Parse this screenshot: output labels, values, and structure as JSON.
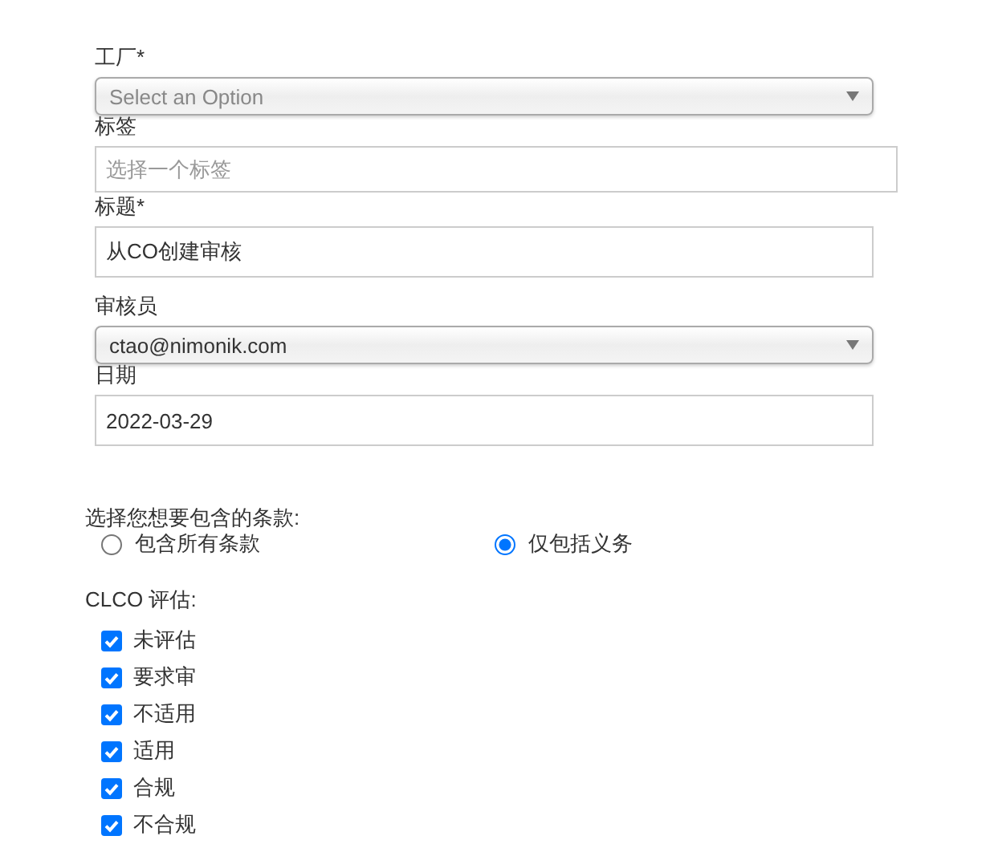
{
  "fields": [
    {
      "kind": "select",
      "label": "工厂*",
      "placeholder": "Select an Option"
    },
    {
      "kind": "tag-input",
      "label": "标签",
      "placeholder": "选择一个标签"
    },
    {
      "kind": "text",
      "label": "标题*",
      "value": "从CO创建审核"
    },
    {
      "kind": "select",
      "label": "审核员",
      "value": "ctao@nimonik.com"
    },
    {
      "kind": "text",
      "label": "日期",
      "value": "2022-03-29"
    }
  ],
  "clauses": {
    "label": "选择您想要包含的条款:",
    "options": [
      {
        "label": "包含所有条款",
        "selected": false
      },
      {
        "label": "仅包括义务",
        "selected": true
      }
    ]
  },
  "evaluation": {
    "label": "CLCO 评估:",
    "options": [
      {
        "label": "未评估",
        "checked": true
      },
      {
        "label": "要求审",
        "checked": true
      },
      {
        "label": "不适用",
        "checked": true
      },
      {
        "label": "适用",
        "checked": true
      },
      {
        "label": "合规",
        "checked": true
      },
      {
        "label": "不合规",
        "checked": true
      }
    ]
  }
}
